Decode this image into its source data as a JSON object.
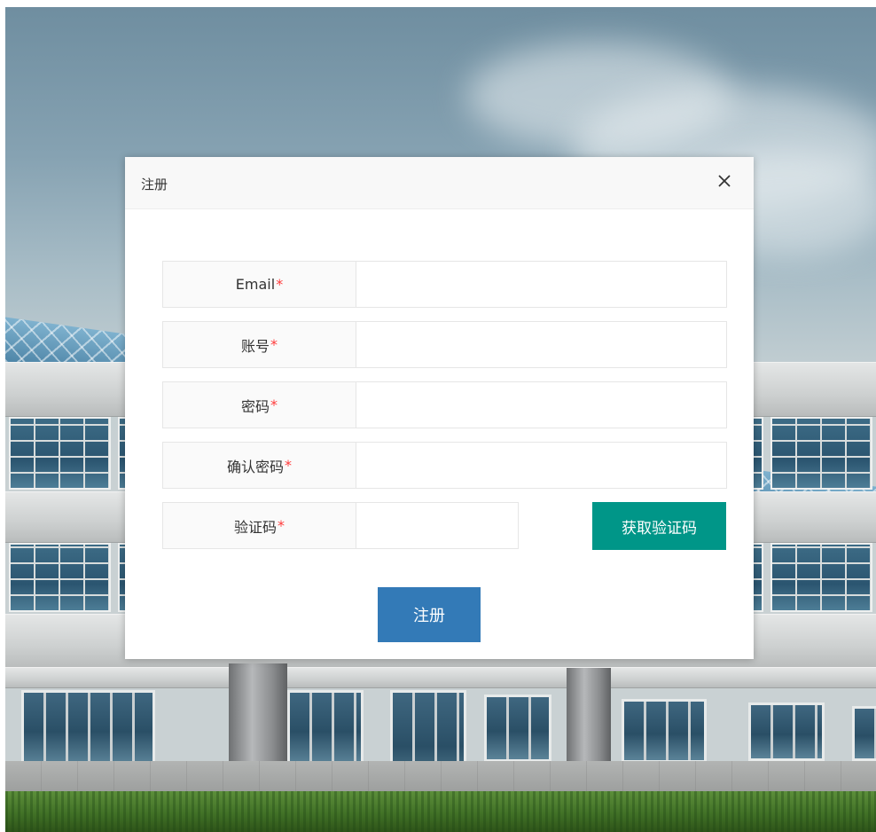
{
  "modal": {
    "title": "注册",
    "submit_label": "注册",
    "fields": [
      {
        "label": "Email",
        "required_mark": "*",
        "value": ""
      },
      {
        "label": "账号",
        "required_mark": "*",
        "value": ""
      },
      {
        "label": "密码",
        "required_mark": "*",
        "value": ""
      },
      {
        "label": "确认密码",
        "required_mark": "*",
        "value": ""
      },
      {
        "label": "验证码",
        "required_mark": "*",
        "value": ""
      }
    ],
    "get_code_label": "获取验证码"
  },
  "icons": {
    "close": "close-icon"
  },
  "colors": {
    "required": "#ff3b3b",
    "code_button": "#009688",
    "submit_button": "#337ab7"
  }
}
